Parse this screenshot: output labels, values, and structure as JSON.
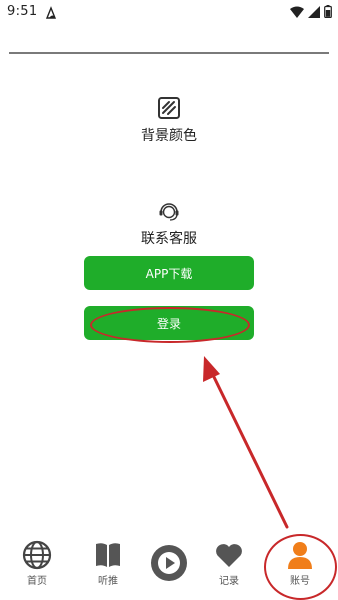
{
  "status_bar": {
    "time": "9:51",
    "icons": [
      "app-notification-icon",
      "wifi-icon",
      "signal-icon",
      "battery-icon"
    ]
  },
  "menu": {
    "background_color_label": "背景颜色",
    "contact_label": "联系客服"
  },
  "buttons": {
    "download_label": "APP下载",
    "login_label": "登录"
  },
  "bottom_nav": {
    "items": [
      {
        "label": "首页",
        "icon": "globe-icon"
      },
      {
        "label": "听推",
        "icon": "book-icon"
      },
      {
        "label": "",
        "icon": "play-icon"
      },
      {
        "label": "记录",
        "icon": "heart-icon"
      },
      {
        "label": "账号",
        "icon": "person-icon"
      }
    ]
  },
  "colors": {
    "button_green": "#1fad2a",
    "accent_orange": "#f07e1a",
    "annotation_red": "#c8282a"
  }
}
